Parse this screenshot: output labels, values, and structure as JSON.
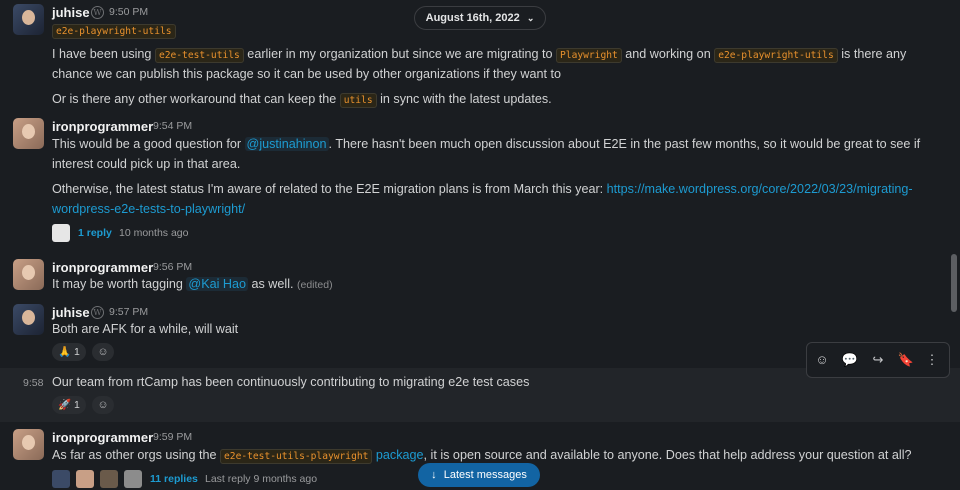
{
  "date_divider": {
    "label": "August 16th, 2022",
    "chevron": "chevron-down-icon"
  },
  "messages": {
    "m1": {
      "author": "juhise",
      "time": "9:50 PM",
      "status_code": "e2e-playwright-utils",
      "p1_a": "I have been using ",
      "p1_code1": "e2e-test-utils",
      "p1_b": " earlier in my organization but since we are migrating to ",
      "p1_code2": "Playwright",
      "p1_c": " and working on ",
      "p1_code3": "e2e-playwright-utils",
      "p1_d": "  is there any",
      "p1_e": "chance we can publish this package so it can be used by other organizations if they want to",
      "p2_a": "Or is there any other workaround that can keep the ",
      "p2_code": "utils",
      "p2_b": "  in sync with the latest updates."
    },
    "m2": {
      "author": "ironprogrammer",
      "time": "9:54 PM",
      "l1_a": "This would be a good question for ",
      "l1_mention": "@justinahinon",
      "l1_b": ". There hasn't been much open discussion about E2E in the past few months, so it would be great to see if",
      "l2": "interest could pick up in that area.",
      "l3_a": "Otherwise, the latest status I'm aware of related to the E2E migration plans is from March this year: ",
      "l3_link": "https://make.wordpress.org/core/2022/03/23/migrating-",
      "l4_link": "wordpress-e2e-tests-to-playwright/",
      "replies": "1 reply",
      "reply_time": "10 months ago"
    },
    "m3": {
      "author": "ironprogrammer",
      "time": "9:56 PM",
      "text_a": "It may be worth tagging ",
      "mention": "@Kai Hao",
      "text_b": " as well. ",
      "edited": "(edited)"
    },
    "m4": {
      "author": "juhise",
      "time": "9:57 PM",
      "text": "Both are AFK for a while, will wait",
      "reaction_emoji": "🙏",
      "reaction_count": "1"
    },
    "m5": {
      "time": "9:58",
      "text": "Our team from rtCamp has been continuously contributing to migrating e2e test cases",
      "reaction_emoji": "🚀",
      "reaction_count": "1"
    },
    "m6": {
      "author": "ironprogrammer",
      "time": "9:59 PM",
      "l1_a": "As far as other orgs using the ",
      "l1_code": "e2e-test-utils-playwright",
      "l1_link": " package",
      "l1_b": ", it is open source and available to anyone. Does that help address your question at all?",
      "replies": "11 replies",
      "reply_time": "Last reply 9 months ago"
    }
  },
  "toolbar": {
    "add_reaction": "add-reaction-icon",
    "reply": "reply-in-thread-icon",
    "forward": "forward-icon",
    "save": "bookmark-icon",
    "more": "more-actions-icon"
  },
  "latest_button": {
    "label": "Latest messages",
    "icon": "arrow-down-icon"
  },
  "colors": {
    "background": "#1a1d21",
    "link": "#1d9bd1",
    "code": "#e8912d",
    "button": "#1264a3"
  }
}
